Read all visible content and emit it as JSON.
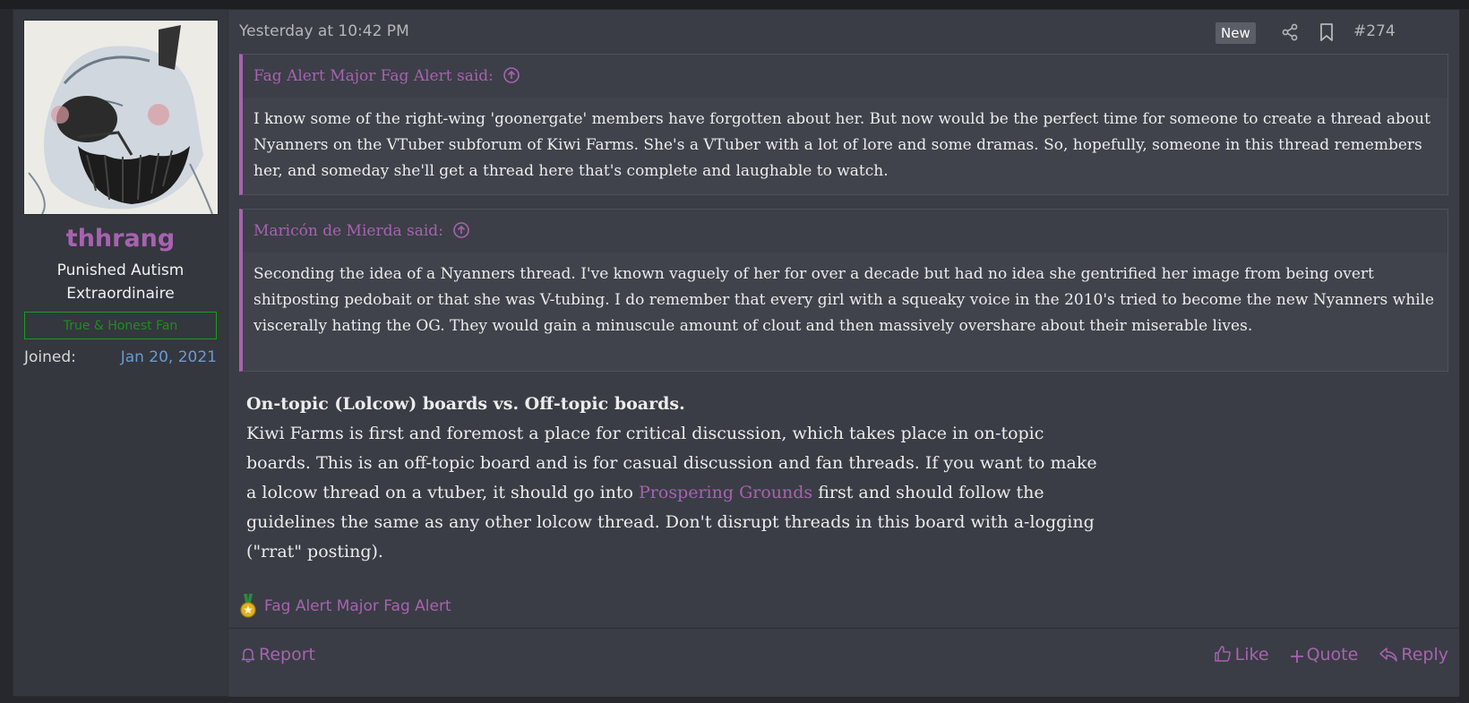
{
  "author": {
    "username": "thhrang",
    "title": "Punished Autism Extraordinaire",
    "banner": "True & Honest Fan",
    "joined_label": "Joined:",
    "joined_date": "Jan 20, 2021"
  },
  "header": {
    "date": "Yesterday at 10:42 PM",
    "new_badge": "New",
    "post_number": "#274"
  },
  "quotes": [
    {
      "author": "Fag Alert Major Fag Alert said:",
      "text": "I know some of the right-wing 'goonergate' members have forgotten about her. But now would be the perfect time for someone to create a thread about Nyanners on the VTuber subforum of Kiwi Farms. She's a VTuber with a lot of lore and some dramas. So, hopefully, someone in this thread remembers her, and someday she'll get a thread here that's complete and laughable to watch."
    },
    {
      "author": "Maricón de Mierda said:",
      "text": "Seconding the idea of a Nyanners thread. I've known vaguely of her for over a decade but had no idea she gentrified her image from being overt shitposting pedobait or that she was V-tubing. I do remember that every girl with a squeaky voice in the 2010's tried to become the new Nyanners while viscerally hating the OG. They would gain a minuscule amount of clout and then massively overshare about their miserable lives."
    }
  ],
  "rules": {
    "title": "On-topic (Lolcow) boards vs. Off-topic boards.",
    "text_before_link": "Kiwi Farms is first and foremost a place for critical discussion, which takes place in on-topic boards. This is an off-topic board and is for casual discussion and fan threads. If you want to make a lolcow thread on a vtuber, it should go into ",
    "link": "Prospering Grounds",
    "text_after_link": " first and should follow the guidelines the same as any other lolcow thread. Don't disrupt threads in this board with a-logging (\"rrat\" posting)."
  },
  "reactions": {
    "user": "Fag Alert Major Fag Alert"
  },
  "footer": {
    "report": "Report",
    "like": "Like",
    "quote": "Quote",
    "reply": "Reply"
  },
  "colors": {
    "accent": "#a862b0",
    "banner_green": "#1c8f1c",
    "link_blue": "#6a9ad0"
  }
}
